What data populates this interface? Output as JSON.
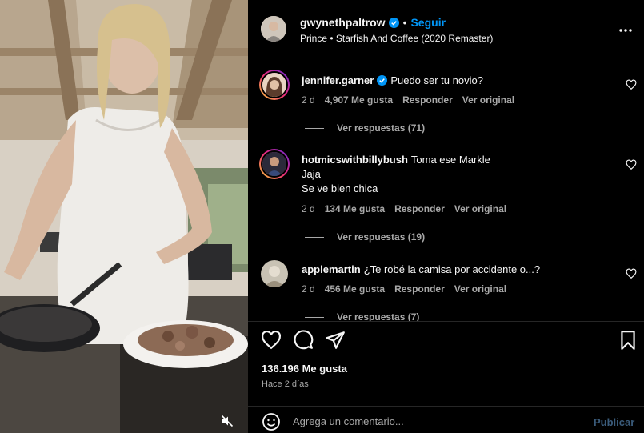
{
  "post": {
    "username": "gwynethpaltrow",
    "separator": "•",
    "follow_label": "Seguir",
    "music": "Prince • Starfish And Coffee (2020 Remaster)",
    "likes": "136.196 Me gusta",
    "posted_ago": "Hace 2 días"
  },
  "comments": [
    {
      "username": "jennifer.garner",
      "verified": true,
      "text": "Puedo ser tu novio?",
      "time": "2 d",
      "likes": "4,907 Me gusta",
      "reply_label": "Responder",
      "original_label": "Ver original",
      "replies_label": "Ver respuestas (71)"
    },
    {
      "username": "hotmicswithbillybush",
      "verified": false,
      "text_line1": "Toma ese Markle",
      "text_line2": "Jaja",
      "text_line3": "Se ve bien chica",
      "time": "2 d",
      "likes": "134 Me gusta",
      "reply_label": "Responder",
      "original_label": "Ver original",
      "replies_label": "Ver respuestas (19)"
    },
    {
      "username": "applemartin",
      "verified": false,
      "text": "¿Te robé la camisa por accidente o...?",
      "time": "2 d",
      "likes": "456 Me gusta",
      "reply_label": "Responder",
      "original_label": "Ver original",
      "replies_label": "Ver respuestas (7)"
    }
  ],
  "composer": {
    "placeholder": "Agrega un comentario...",
    "publish_label": "Publicar"
  },
  "colors": {
    "background": "#000000",
    "link_blue": "#0095f6",
    "muted_text": "#a8a8a8",
    "divider": "#262626"
  },
  "icons": [
    "verified-badge-icon",
    "more-options-icon",
    "heart-icon",
    "comment-icon",
    "share-icon",
    "bookmark-icon",
    "emoji-icon",
    "muted-speaker-icon"
  ]
}
